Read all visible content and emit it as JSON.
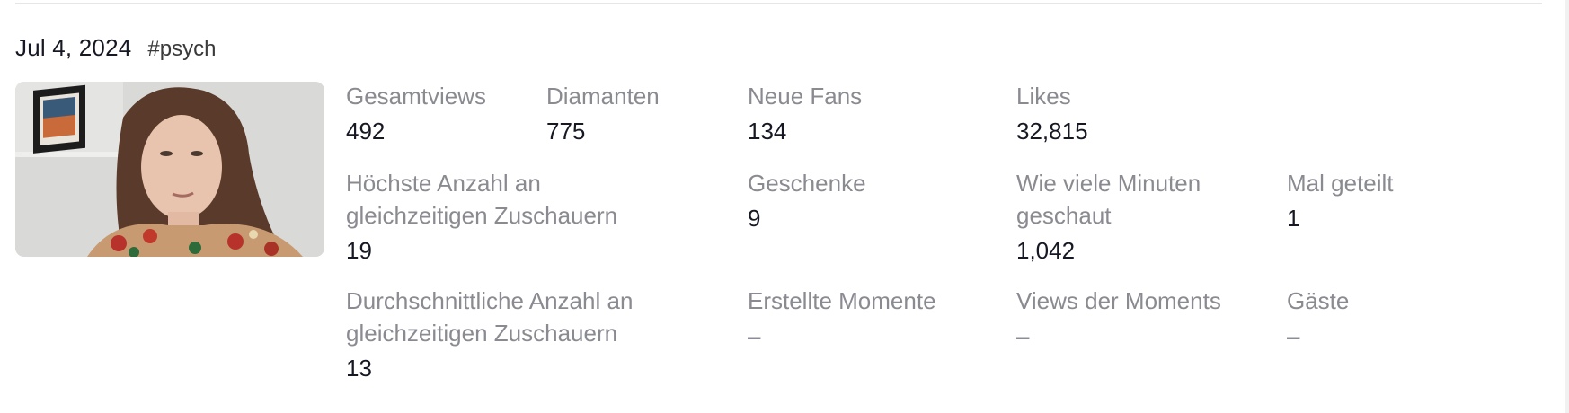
{
  "session": {
    "date": "Jul 4, 2024",
    "tag": "#psych"
  },
  "stats": {
    "total_views": {
      "label": "Gesamtviews",
      "value": "492"
    },
    "diamonds": {
      "label": "Diamanten",
      "value": "775"
    },
    "new_fans": {
      "label": "Neue Fans",
      "value": "134"
    },
    "likes": {
      "label": "Likes",
      "value": "32,815"
    },
    "peak_viewers": {
      "label": "Höchste Anzahl an gleichzeitigen Zuschauern",
      "value": "19"
    },
    "gifts": {
      "label": "Geschenke",
      "value": "9"
    },
    "minutes_watched": {
      "label": "Wie viele Minuten geschaut",
      "value": "1,042"
    },
    "shares": {
      "label": "Mal geteilt",
      "value": "1"
    },
    "avg_viewers": {
      "label": "Durchschnittliche Anzahl an gleichzeitigen Zuschauern",
      "value": "13"
    },
    "moments_created": {
      "label": "Erstellte Momente",
      "value": "–"
    },
    "moment_views": {
      "label": "Views der Moments",
      "value": "–"
    },
    "guests": {
      "label": "Gäste",
      "value": "–"
    }
  }
}
